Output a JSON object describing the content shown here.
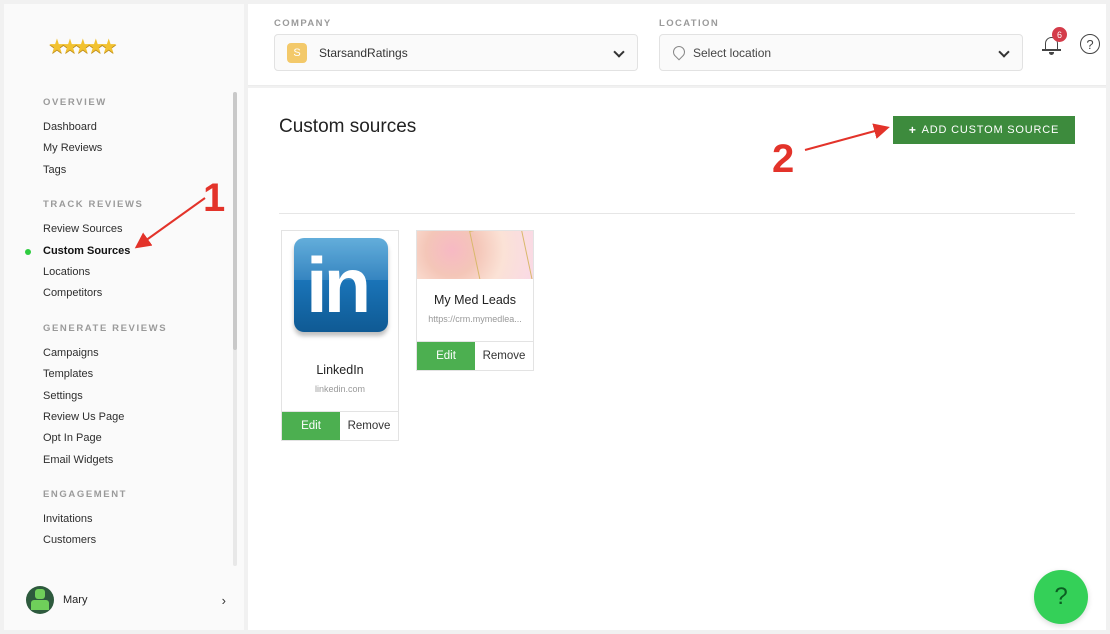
{
  "sidebar": {
    "logo_icon": "five-stars-logo",
    "sections": [
      {
        "title": "OVERVIEW",
        "items": [
          "Dashboard",
          "My Reviews",
          "Tags"
        ]
      },
      {
        "title": "TRACK REVIEWS",
        "items": [
          "Review Sources",
          "Custom Sources",
          "Locations",
          "Competitors"
        ]
      },
      {
        "title": "GENERATE REVIEWS",
        "items": [
          "Campaigns",
          "Templates",
          "Settings",
          "Review Us Page",
          "Opt In Page",
          "Email Widgets"
        ]
      },
      {
        "title": "ENGAGEMENT",
        "items": [
          "Invitations",
          "Customers"
        ]
      }
    ],
    "active_item": "Custom Sources",
    "user": {
      "name": "Mary",
      "chevron": "›"
    }
  },
  "header": {
    "company": {
      "label": "COMPANY",
      "badge": "S",
      "value": "StarsandRatings"
    },
    "location": {
      "label": "LOCATION",
      "placeholder": "Select location"
    },
    "notifications_count": "6",
    "help_icon": "?"
  },
  "main": {
    "title": "Custom sources",
    "add_button": "ADD CUSTOM SOURCE",
    "cards": [
      {
        "name": "LinkedIn",
        "url": "linkedin.com",
        "logo_text": "in",
        "edit": "Edit",
        "remove": "Remove"
      },
      {
        "name": "My Med Leads",
        "url": "https://crm.mymedlea...",
        "edit": "Edit",
        "remove": "Remove"
      }
    ]
  },
  "annotations": {
    "one": "1",
    "two": "2",
    "color": "#e3332a"
  },
  "help_fab": "?"
}
